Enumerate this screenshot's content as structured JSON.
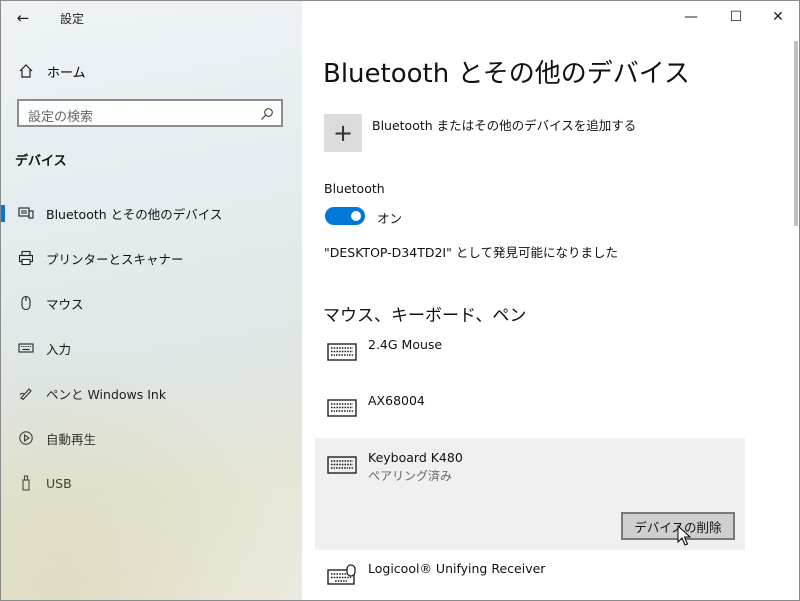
{
  "window": {
    "title": "設定",
    "controls": {
      "minimize": "—",
      "maximize": "☐",
      "close": "✕"
    }
  },
  "sidebar": {
    "back_icon": "←",
    "home_label": "ホーム",
    "home_icon": "⌂",
    "search_placeholder": "設定の検索",
    "search_icon": "⚲",
    "section_title": "デバイス",
    "items": [
      {
        "label": "Bluetooth とその他のデバイス",
        "icon": "bluetooth-devices-icon",
        "selected": true
      },
      {
        "label": "プリンターとスキャナー",
        "icon": "printer-icon",
        "selected": false
      },
      {
        "label": "マウス",
        "icon": "mouse-icon",
        "selected": false
      },
      {
        "label": "入力",
        "icon": "keyboard-icon",
        "selected": false
      },
      {
        "label": "ペンと Windows Ink",
        "icon": "pen-icon",
        "selected": false
      },
      {
        "label": "自動再生",
        "icon": "autoplay-icon",
        "selected": false
      },
      {
        "label": "USB",
        "icon": "usb-icon",
        "selected": false
      }
    ]
  },
  "main": {
    "title": "Bluetooth とその他のデバイス",
    "add_device_icon": "+",
    "add_device_label": "Bluetooth またはその他のデバイスを追加する",
    "bluetooth_label": "Bluetooth",
    "bluetooth_state": "オン",
    "bluetooth_on": true,
    "discoverable_text": "\"DESKTOP-D34TD2I\" として発見可能になりました",
    "section_title": "マウス、キーボード、ペン",
    "devices": [
      {
        "name": "2.4G Mouse",
        "status": "",
        "icon": "keyboard-icon"
      },
      {
        "name": "AX68004",
        "status": "",
        "icon": "keyboard-icon"
      },
      {
        "name": "Keyboard K480",
        "status": "ペアリング済み",
        "icon": "keyboard-icon",
        "selected": true
      },
      {
        "name": "Logicool® Unifying Receiver",
        "status": "",
        "icon": "keyboard-mouse-icon"
      }
    ],
    "remove_button_label": "デバイスの削除"
  },
  "colors": {
    "accent": "#0078d7",
    "selected_row": "#f0f0f0",
    "button_bg": "#cfcfcf"
  }
}
